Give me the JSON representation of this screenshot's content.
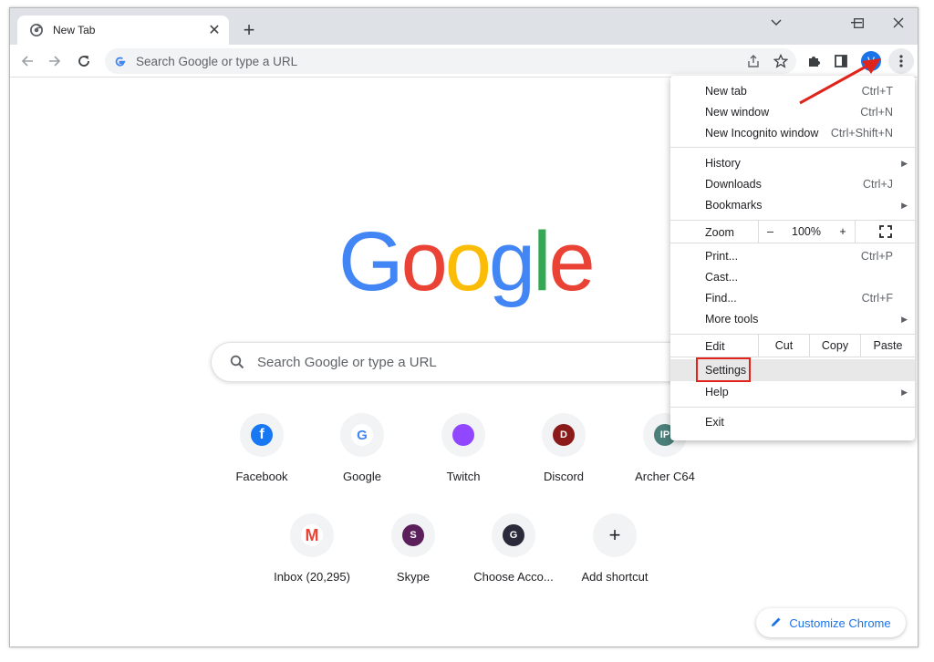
{
  "tab": {
    "title": "New Tab"
  },
  "omnibox": {
    "placeholder": "Search Google or type a URL"
  },
  "profile": {
    "initial": "V"
  },
  "logo": {
    "letters": [
      "G",
      "o",
      "o",
      "g",
      "l",
      "e"
    ],
    "colors": [
      "#4285f4",
      "#ea4335",
      "#fbbc05",
      "#4285f4",
      "#34a853",
      "#ea4335"
    ]
  },
  "search": {
    "placeholder": "Search Google or type a URL"
  },
  "shortcuts": [
    {
      "label": "Facebook",
      "glyph": "f",
      "color": "#1877f2"
    },
    {
      "label": "Google",
      "glyph": "G",
      "color": "#ffffff"
    },
    {
      "label": "Twitch",
      "glyph": "",
      "color": "#9146ff"
    },
    {
      "label": "Discord",
      "glyph": "D",
      "color": "#8b1a1a"
    },
    {
      "label": "Archer C64",
      "glyph": "IP",
      "color": "#4b7f7a"
    },
    {
      "label": "Inbox (20,295)",
      "glyph": "M",
      "color": "#ffffff"
    },
    {
      "label": "Skype",
      "glyph": "S",
      "color": "#5b1f5c"
    },
    {
      "label": "Choose Acco...",
      "glyph": "G",
      "color": "#2a2a3a"
    },
    {
      "label": "Add shortcut",
      "glyph": "+",
      "color": "#f1f3f4"
    }
  ],
  "customize": {
    "label": "Customize Chrome"
  },
  "menu": {
    "new_tab": {
      "label": "New tab",
      "accel": "Ctrl+T"
    },
    "new_window": {
      "label": "New window",
      "accel": "Ctrl+N"
    },
    "incognito": {
      "label": "New Incognito window",
      "accel": "Ctrl+Shift+N"
    },
    "history": {
      "label": "History"
    },
    "downloads": {
      "label": "Downloads",
      "accel": "Ctrl+J"
    },
    "bookmarks": {
      "label": "Bookmarks"
    },
    "zoom": {
      "label": "Zoom",
      "minus": "–",
      "value": "100%",
      "plus": "+"
    },
    "print": {
      "label": "Print...",
      "accel": "Ctrl+P"
    },
    "cast": {
      "label": "Cast..."
    },
    "find": {
      "label": "Find...",
      "accel": "Ctrl+F"
    },
    "more_tools": {
      "label": "More tools"
    },
    "edit": {
      "label": "Edit",
      "cut": "Cut",
      "copy": "Copy",
      "paste": "Paste"
    },
    "settings": {
      "label": "Settings"
    },
    "help": {
      "label": "Help"
    },
    "exit": {
      "label": "Exit"
    }
  },
  "colors": {
    "accent": "#1a73e8",
    "annotation_red": "#e0241b"
  }
}
